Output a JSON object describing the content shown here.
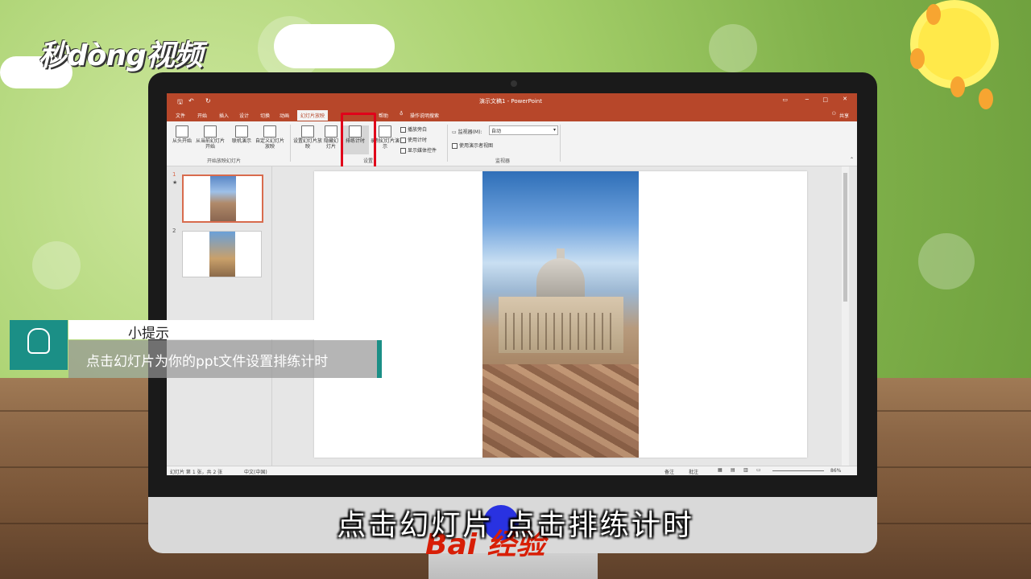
{
  "brand": {
    "logo_text": "秒dòng视频"
  },
  "window": {
    "title": "演示文稿1 - PowerPoint"
  },
  "tabs": [
    "文件",
    "开始",
    "插入",
    "设计",
    "切换",
    "动画",
    "幻灯片放映",
    "帮助"
  ],
  "tabs_active": "幻灯片放映",
  "tell_me": "操作说明搜索",
  "share": "共享",
  "ribbon": {
    "from_start": "从头开始",
    "from_current": "从当前幻灯片开始",
    "online": "联机演示",
    "custom": "自定义幻灯片放映",
    "group_start": "开始放映幻灯片",
    "setup": "设置幻灯片放映",
    "hide": "隐藏幻灯片",
    "rehearse": "排练计时",
    "record": "录制幻灯片演示",
    "play_narration": "播放旁白",
    "use_timing": "使用计时",
    "show_media": "显示媒体控件",
    "group_setup": "设置",
    "monitor_label": "监视器(M):",
    "monitor_value": "自动",
    "presenter_view": "使用演示者视图",
    "group_monitor": "监视器"
  },
  "thumbs": [
    {
      "num": "1"
    },
    {
      "num": "2"
    }
  ],
  "thumb1_star": "★",
  "status": {
    "slide": "幻灯片 第 1 张，共 2 张",
    "lang": "中文(中国)",
    "notes": "备注",
    "comments": "批注",
    "zoom": "86%"
  },
  "tip": {
    "title": "小提示",
    "body": "点击幻灯片为你的ppt文件设置排练计时"
  },
  "subtitle": "点击幻灯片  点击排练计时",
  "watermark": {
    "text": "Bai   经验"
  },
  "colors": {
    "accent": "#b7472a",
    "teal": "#1b8f86",
    "highlight": "#e0001a"
  }
}
